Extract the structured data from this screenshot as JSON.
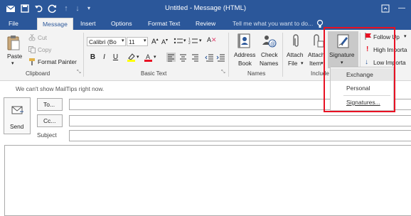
{
  "window": {
    "title": "Untitled - Message (HTML)"
  },
  "quick_access": [
    "save-icon",
    "undo-icon",
    "redo-icon",
    "up-arrow-icon",
    "down-arrow-icon"
  ],
  "tabs": [
    {
      "label": "File"
    },
    {
      "label": "Message"
    },
    {
      "label": "Insert"
    },
    {
      "label": "Options"
    },
    {
      "label": "Format Text"
    },
    {
      "label": "Review"
    }
  ],
  "tell_me": {
    "text": "Tell me what you want to do..."
  },
  "ribbon": {
    "clipboard": {
      "paste": "Paste",
      "cut": "Cut",
      "copy": "Copy",
      "format_painter": "Format Painter",
      "group": "Clipboard"
    },
    "basic_text": {
      "font": "Calibri (Bo",
      "size": "11",
      "group": "Basic Text"
    },
    "names": {
      "address_book_1": "Address",
      "address_book_2": "Book",
      "check_names_1": "Check",
      "check_names_2": "Names",
      "group": "Names"
    },
    "include": {
      "attach_file_1": "Attach",
      "attach_file_2": "File",
      "attach_item_1": "Attach",
      "attach_item_2": "Item",
      "signature": "Signature",
      "group": "Include"
    },
    "tags": {
      "follow_up": "Follow Up",
      "high_importance": "High Importa",
      "low_importance": "Low Importa"
    }
  },
  "mailtips": "We can't show MailTips right now.",
  "compose": {
    "send": "Send",
    "to": "To...",
    "cc": "Cc...",
    "subject": "Subject"
  },
  "signature_menu": [
    "Exchange",
    "Personal",
    "Signatures..."
  ],
  "colors": {
    "accent": "#2b579a",
    "highlight": "#e81123",
    "ribbon_bg": "#f3f3f3"
  }
}
